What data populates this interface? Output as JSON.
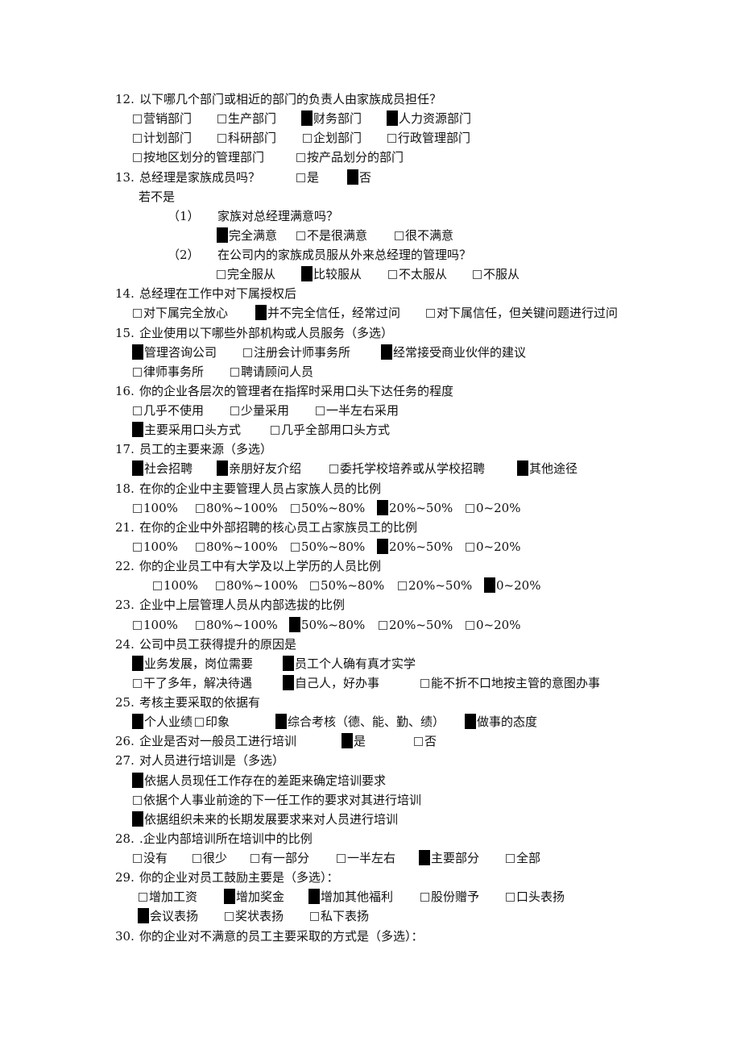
{
  "questions": [
    {
      "id": "q12",
      "num": "12.",
      "text": "以下哪几个部门或相近的部门的负责人由家族成员担任？"
    },
    {
      "id": "q13",
      "num": "13.",
      "text": "总经理是家族成员吗？"
    },
    {
      "id": "q13_sub",
      "text": "若不是"
    },
    {
      "id": "q13_1",
      "num": "（1）",
      "text": "家族对总经理满意吗？"
    },
    {
      "id": "q13_2",
      "num": "（2）",
      "text": "在公司内的家族成员服从外来总经理的管理吗？"
    },
    {
      "id": "q14",
      "num": "14.",
      "text": "总经理在工作中对下属授权后"
    },
    {
      "id": "q15",
      "num": "15.",
      "text": "企业使用以下哪些外部机构或人员服务（多选）"
    },
    {
      "id": "q16",
      "num": "16.",
      "text": "你的企业各层次的管理者在指挥时采用口头下达任务的程度"
    },
    {
      "id": "q17",
      "num": "17.",
      "text": "员工的主要来源（多选）"
    },
    {
      "id": "q18",
      "num": "18.",
      "text": "在你的企业中主要管理人员占家族人员的比例"
    },
    {
      "id": "q21",
      "num": "21.",
      "text": "在你的企业中外部招聘的核心员工占家族员工的比例"
    },
    {
      "id": "q22",
      "num": "22.",
      "text": "你的企业员工中有大学及以上学历的人员比例"
    },
    {
      "id": "q23",
      "num": "23.",
      "text": "企业中上层管理人员从内部选拔的比例"
    },
    {
      "id": "q24",
      "num": "24.",
      "text": "公司中员工获得提升的原因是"
    },
    {
      "id": "q25",
      "num": "25.",
      "text": "考核主要采取的依据有"
    },
    {
      "id": "q26",
      "num": "26.",
      "text": "企业是否对一般员工进行培训"
    },
    {
      "id": "q27",
      "num": "27.",
      "text": "对人员进行培训是（多选）"
    },
    {
      "id": "q28",
      "num": "28.",
      "text": ".企业内部培训所在培训中的比例"
    },
    {
      "id": "q29",
      "num": "29.",
      "text": "你的企业对员工鼓励主要是（多选）："
    },
    {
      "id": "q30",
      "num": "30.",
      "text": "你的企业对不满意的员工主要采取的方式是（多选）："
    }
  ],
  "options": {
    "q12_r1": [
      {
        "label": "营销部门",
        "checked": false
      },
      {
        "label": "生产部门",
        "checked": false
      },
      {
        "label": "财务部门",
        "checked": true
      },
      {
        "label": "人力资源部门",
        "checked": true
      }
    ],
    "q12_r2": [
      {
        "label": "计划部门",
        "checked": false
      },
      {
        "label": "科研部门",
        "checked": false
      },
      {
        "label": "企划部门",
        "checked": false
      },
      {
        "label": "行政管理部门",
        "checked": false
      }
    ],
    "q12_r3": [
      {
        "label": "按地区划分的管理部门",
        "checked": false
      },
      {
        "label": "按产品划分的部门",
        "checked": false
      }
    ],
    "q13": [
      {
        "label": "是",
        "checked": false
      },
      {
        "label": "否",
        "checked": true
      }
    ],
    "q13_1": [
      {
        "label": "完全满意",
        "checked": true
      },
      {
        "label": "不是很满意",
        "checked": false
      },
      {
        "label": "很不满意",
        "checked": false
      }
    ],
    "q13_2": [
      {
        "label": "完全服从",
        "checked": false
      },
      {
        "label": "比较服从",
        "checked": true
      },
      {
        "label": "不太服从",
        "checked": false
      },
      {
        "label": "不服从",
        "checked": false
      }
    ],
    "q14": [
      {
        "label": "对下属完全放心",
        "checked": false
      },
      {
        "label": "并不完全信任，经常过问",
        "checked": true
      },
      {
        "label": "对下属信任，但关键问题进行过问",
        "checked": false
      }
    ],
    "q15_r1": [
      {
        "label": "管理咨询公司",
        "checked": true
      },
      {
        "label": "注册会计师事务所",
        "checked": false
      },
      {
        "label": "经常接受商业伙伴的建议",
        "checked": true
      }
    ],
    "q15_r2": [
      {
        "label": "律师事务所",
        "checked": false
      },
      {
        "label": "聘请顾问人员",
        "checked": false
      }
    ],
    "q16_r1": [
      {
        "label": "几乎不使用",
        "checked": false
      },
      {
        "label": "少量采用",
        "checked": false
      },
      {
        "label": "一半左右采用",
        "checked": false
      }
    ],
    "q16_r2": [
      {
        "label": "主要采用口头方式",
        "checked": true
      },
      {
        "label": "几乎全部用口头方式",
        "checked": false
      }
    ],
    "q17": [
      {
        "label": "社会招聘",
        "checked": true
      },
      {
        "label": "亲朋好友介绍",
        "checked": true
      },
      {
        "label": "委托学校培养或从学校招聘",
        "checked": false
      },
      {
        "label": "其他途径",
        "checked": true
      }
    ],
    "q18": [
      {
        "label": "100%",
        "checked": false
      },
      {
        "label": "80%~100%",
        "checked": false
      },
      {
        "label": "50%~80%",
        "checked": false
      },
      {
        "label": "20%~50%",
        "checked": true
      },
      {
        "label": "0~20%",
        "checked": false
      }
    ],
    "q21": [
      {
        "label": "100%",
        "checked": false
      },
      {
        "label": "80%~100%",
        "checked": false
      },
      {
        "label": "50%~80%",
        "checked": false
      },
      {
        "label": "20%~50%",
        "checked": true
      },
      {
        "label": "0~20%",
        "checked": false
      }
    ],
    "q22": [
      {
        "label": "100%",
        "checked": false
      },
      {
        "label": "80%~100%",
        "checked": false
      },
      {
        "label": "50%~80%",
        "checked": false
      },
      {
        "label": "20%~50%",
        "checked": false
      },
      {
        "label": "0~20%",
        "checked": true
      }
    ],
    "q23": [
      {
        "label": "100%",
        "checked": false
      },
      {
        "label": "80%~100%",
        "checked": false
      },
      {
        "label": "50%~80%",
        "checked": true
      },
      {
        "label": "20%~50%",
        "checked": false
      },
      {
        "label": "0~20%",
        "checked": false
      }
    ],
    "q24_r1": [
      {
        "label": "业务发展，岗位需要",
        "checked": true
      },
      {
        "label": "员工个人确有真才实学",
        "checked": true
      }
    ],
    "q24_r2": [
      {
        "label": "干了多年，解决待遇",
        "checked": false
      },
      {
        "label": "自己人，好办事",
        "checked": true
      },
      {
        "label": "能不折不口地按主管的意图办事",
        "checked": false
      }
    ],
    "q25": [
      {
        "label": "个人业绩",
        "checked": true
      },
      {
        "label": "印象",
        "checked": false
      },
      {
        "label": "综合考核（德、能、勤、绩）",
        "checked": true
      },
      {
        "label": "做事的态度",
        "checked": true
      }
    ],
    "q26": [
      {
        "label": "是",
        "checked": true
      },
      {
        "label": "否",
        "checked": false
      }
    ],
    "q27_r1": [
      {
        "label": "依据人员现任工作存在的差距来确定培训要求",
        "checked": true
      }
    ],
    "q27_r2": [
      {
        "label": "依据个人事业前途的下一任工作的要求对其进行培训",
        "checked": false
      }
    ],
    "q27_r3": [
      {
        "label": "依据组织未来的长期发展要求来对人员进行培训",
        "checked": true
      }
    ],
    "q28": [
      {
        "label": "没有",
        "checked": false
      },
      {
        "label": "很少",
        "checked": false
      },
      {
        "label": "有一部分",
        "checked": false
      },
      {
        "label": "一半左右",
        "checked": false
      },
      {
        "label": "主要部分",
        "checked": true
      },
      {
        "label": "全部",
        "checked": false
      }
    ],
    "q29_r1": [
      {
        "label": "增加工资",
        "checked": false
      },
      {
        "label": "增加奖金",
        "checked": true
      },
      {
        "label": "增加其他福利",
        "checked": true
      },
      {
        "label": "股份赠予",
        "checked": false
      },
      {
        "label": "口头表扬",
        "checked": false
      }
    ],
    "q29_r2": [
      {
        "label": "会议表扬",
        "checked": true
      },
      {
        "label": "奖状表扬",
        "checked": false
      },
      {
        "label": "私下表扬",
        "checked": false
      }
    ]
  }
}
